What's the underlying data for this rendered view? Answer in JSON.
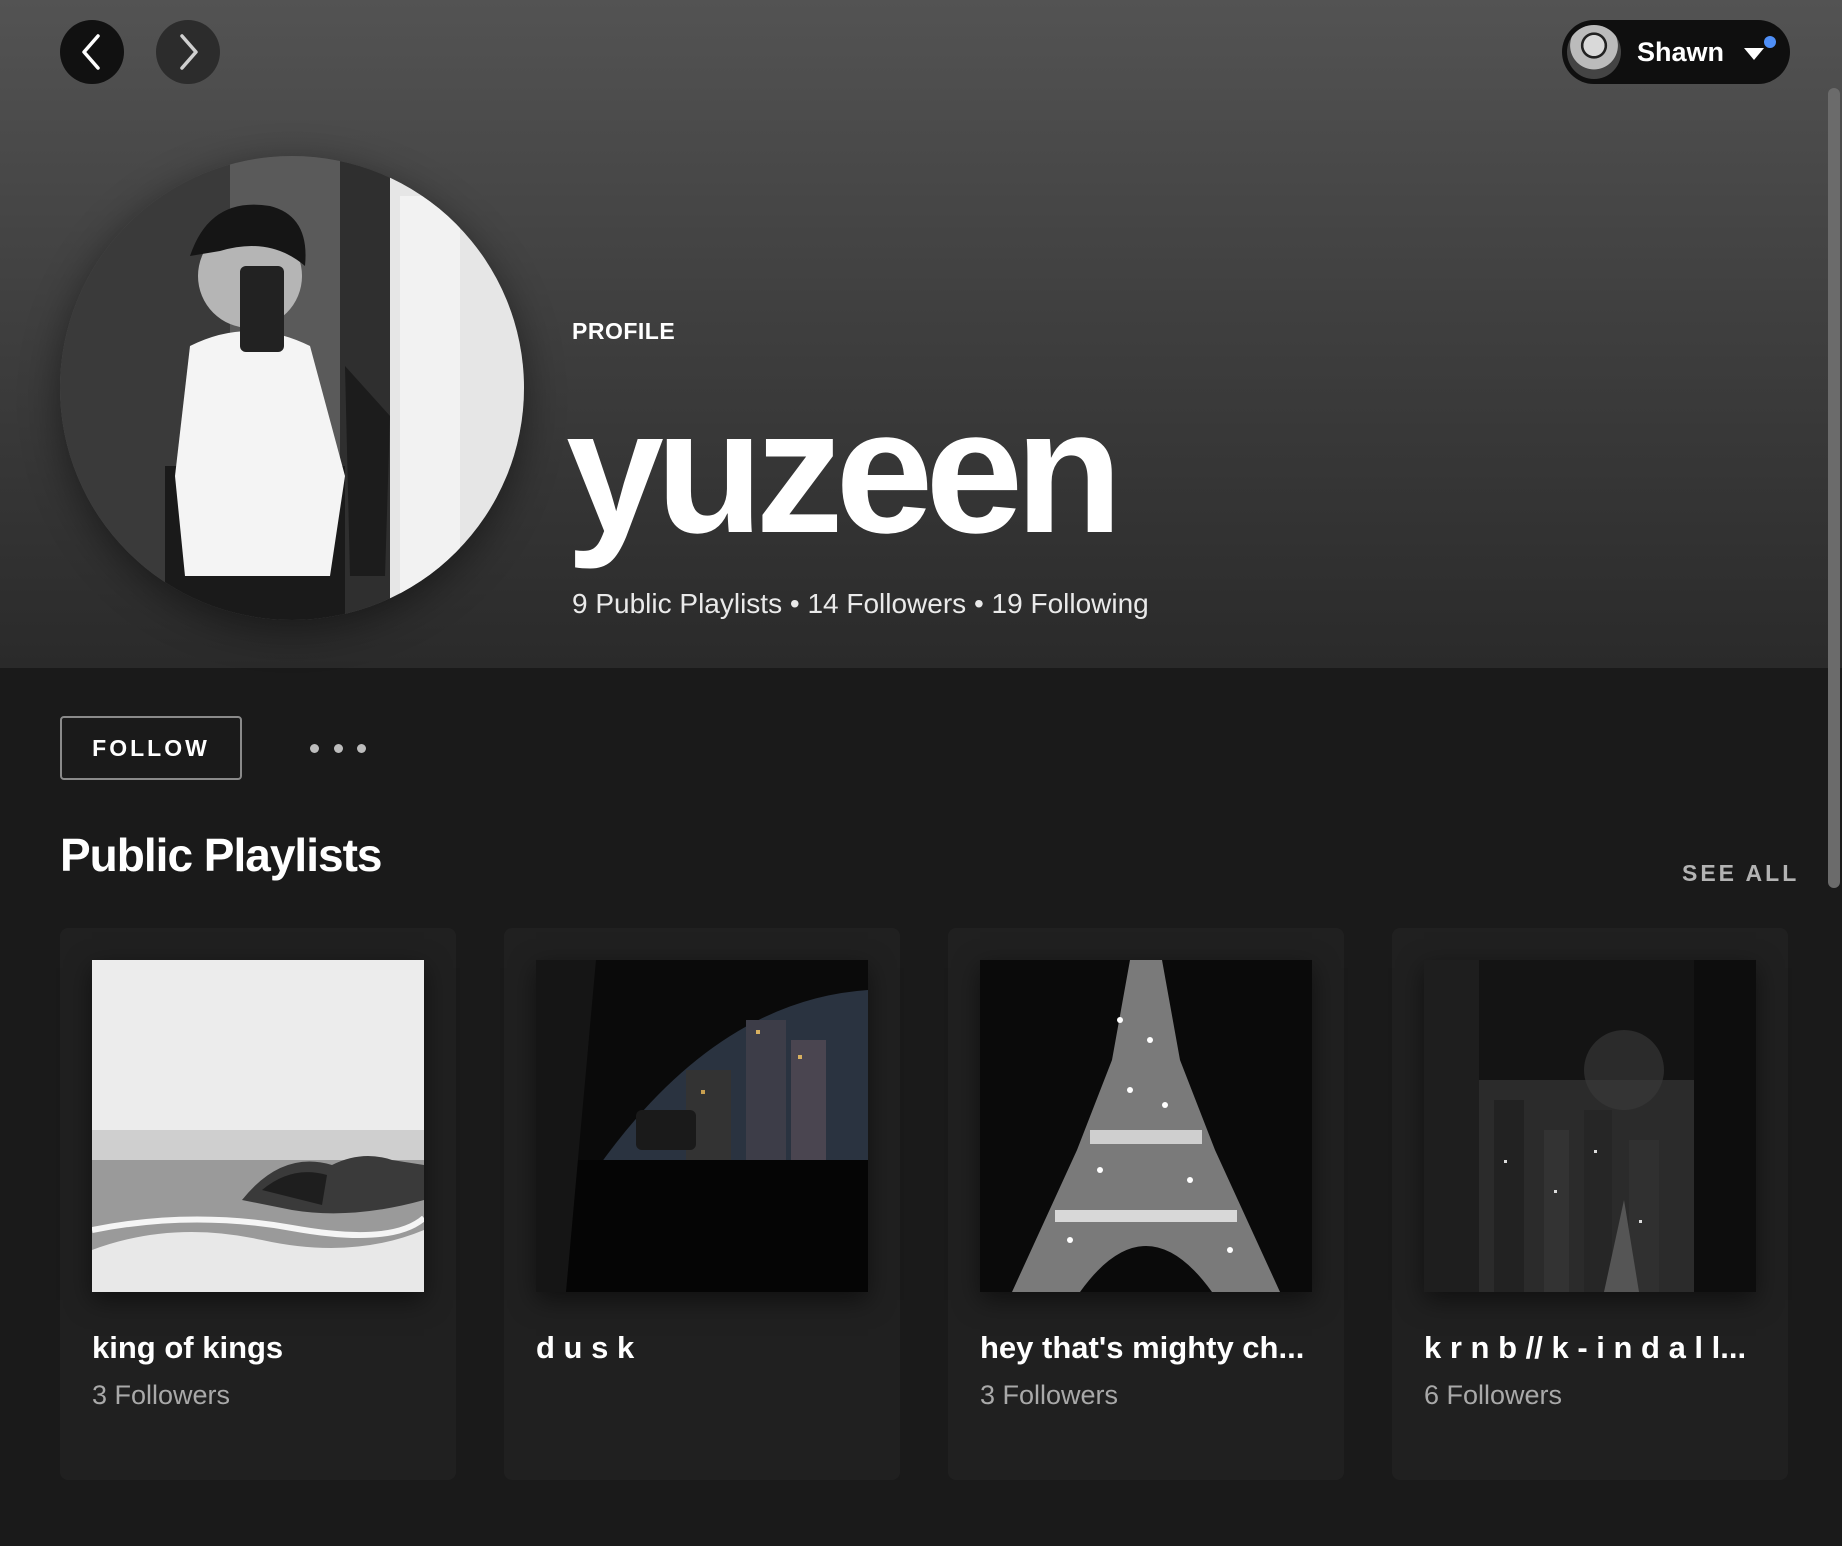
{
  "topbar": {
    "back_icon": "chevron-left-icon",
    "forward_icon": "chevron-right-icon",
    "user_name": "Shawn"
  },
  "profile": {
    "label": "PROFILE",
    "name": "yuzeen",
    "stats": "9 Public Playlists • 14 Followers • 19 Following"
  },
  "actions": {
    "follow_label": "FOLLOW"
  },
  "public_playlists": {
    "title": "Public Playlists",
    "see_all": "SEE ALL",
    "items": [
      {
        "title": "king of kings",
        "subtitle": "3 Followers"
      },
      {
        "title": "d u s k",
        "subtitle": ""
      },
      {
        "title": "hey that's mighty ch...",
        "subtitle": "3 Followers"
      },
      {
        "title": "k r n b // k - i n d a l l...",
        "subtitle": "6 Followers"
      }
    ]
  },
  "colors": {
    "background": "#1a1a1a",
    "header_gradient_top": "#535353",
    "notification_dot": "#4f8ff7"
  }
}
